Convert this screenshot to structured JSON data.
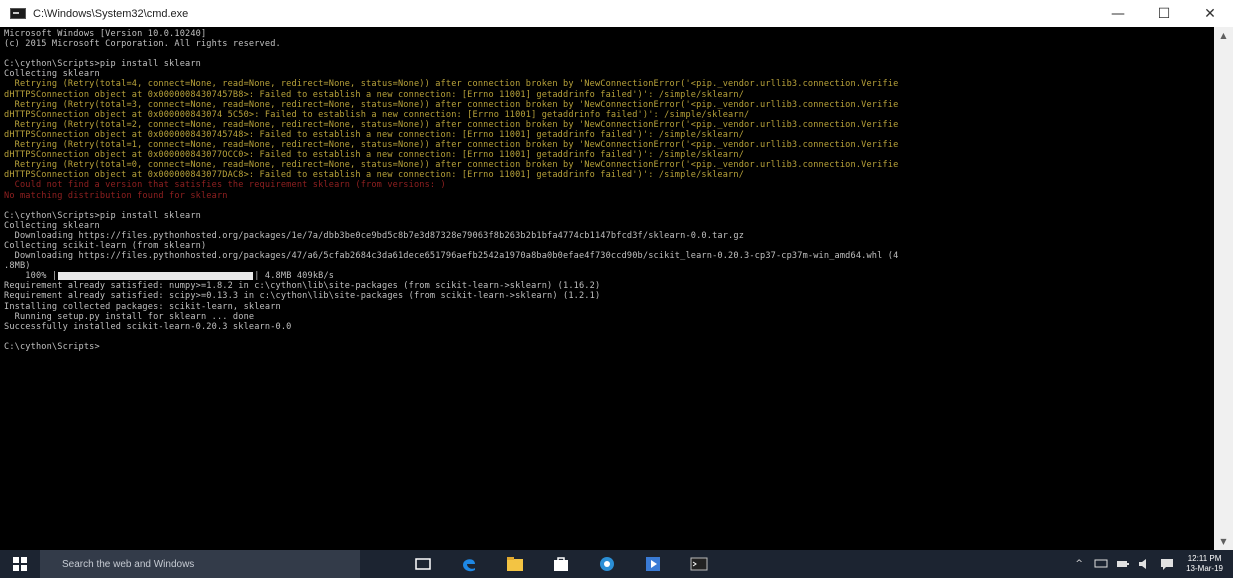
{
  "window": {
    "title": "C:\\Windows\\System32\\cmd.exe",
    "controls": {
      "minimize": "—",
      "maximize": "☐",
      "close": "✕"
    }
  },
  "console": {
    "lines": [
      {
        "text": "Microsoft Windows [Version 10.0.10240]",
        "style": "normal"
      },
      {
        "text": "(c) 2015 Microsoft Corporation. All rights reserved.",
        "style": "normal"
      },
      {
        "text": "",
        "style": "normal"
      },
      {
        "text": "C:\\cython\\Scripts>pip install sklearn",
        "style": "normal"
      },
      {
        "text": "Collecting sklearn",
        "style": "normal"
      },
      {
        "text": "  Retrying (Retry(total=4, connect=None, read=None, redirect=None, status=None)) after connection broken by 'NewConnectionError('<pip._vendor.urllib3.connection.Verifie",
        "style": "warn"
      },
      {
        "text": "dHTTPSConnection object at 0x00000084307457B8>: Failed to establish a new connection: [Errno 11001] getaddrinfo failed')': /simple/sklearn/",
        "style": "warn"
      },
      {
        "text": "  Retrying (Retry(total=3, connect=None, read=None, redirect=None, status=None)) after connection broken by 'NewConnectionError('<pip._vendor.urllib3.connection.Verifie",
        "style": "warn"
      },
      {
        "text": "dHTTPSConnection object at 0x000000843074 5C50>: Failed to establish a new connection: [Errno 11001] getaddrinfo failed')': /simple/sklearn/",
        "style": "warn"
      },
      {
        "text": "  Retrying (Retry(total=2, connect=None, read=None, redirect=None, status=None)) after connection broken by 'NewConnectionError('<pip._vendor.urllib3.connection.Verifie",
        "style": "warn"
      },
      {
        "text": "dHTTPSConnection object at 0x0000008430745748>: Failed to establish a new connection: [Errno 11001] getaddrinfo failed')': /simple/sklearn/",
        "style": "warn"
      },
      {
        "text": "  Retrying (Retry(total=1, connect=None, read=None, redirect=None, status=None)) after connection broken by 'NewConnectionError('<pip._vendor.urllib3.connection.Verifie",
        "style": "warn"
      },
      {
        "text": "dHTTPSConnection object at 0x000000843077OCC0>: Failed to establish a new connection: [Errno 11001] getaddrinfo failed')': /simple/sklearn/",
        "style": "warn"
      },
      {
        "text": "  Retrying (Retry(total=0, connect=None, read=None, redirect=None, status=None)) after connection broken by 'NewConnectionError('<pip._vendor.urllib3.connection.Verifie",
        "style": "warn"
      },
      {
        "text": "dHTTPSConnection object at 0x000000843077DAC8>: Failed to establish a new connection: [Errno 11001] getaddrinfo failed')': /simple/sklearn/",
        "style": "warn"
      },
      {
        "text": "  Could not find a version that satisfies the requirement sklearn (from versions: )",
        "style": "err"
      },
      {
        "text": "No matching distribution found for sklearn",
        "style": "err"
      },
      {
        "text": "",
        "style": "normal"
      },
      {
        "text": "C:\\cython\\Scripts>pip install sklearn",
        "style": "normal"
      },
      {
        "text": "Collecting sklearn",
        "style": "normal"
      },
      {
        "text": "  Downloading https://files.pythonhosted.org/packages/1e/7a/dbb3be0ce9bd5c8b7e3d87328e79063f8b263b2b1bfa4774cb1147bfcd3f/sklearn-0.0.tar.gz",
        "style": "normal"
      },
      {
        "text": "Collecting scikit-learn (from sklearn)",
        "style": "normal"
      },
      {
        "text": "  Downloading https://files.pythonhosted.org/packages/47/a6/5cfab2684c3da61dece651796aefb2542a1970a8ba0b0efae4f730ccd90b/scikit_learn-0.20.3-cp37-cp37m-win_amd64.whl (4",
        "style": "normal"
      },
      {
        "text": ".8MB)",
        "style": "normal"
      }
    ],
    "progress": {
      "percent_label": "    100% |",
      "fraction": 1.0,
      "suffix": "| 4.8MB 409kB/s"
    },
    "lines_after": [
      {
        "text": "Requirement already satisfied: numpy>=1.8.2 in c:\\cython\\lib\\site-packages (from scikit-learn->sklearn) (1.16.2)",
        "style": "normal"
      },
      {
        "text": "Requirement already satisfied: scipy>=0.13.3 in c:\\cython\\lib\\site-packages (from scikit-learn->sklearn) (1.2.1)",
        "style": "normal"
      },
      {
        "text": "Installing collected packages: scikit-learn, sklearn",
        "style": "normal"
      },
      {
        "text": "  Running setup.py install for sklearn ... done",
        "style": "normal"
      },
      {
        "text": "Successfully installed scikit-learn-0.20.3 sklearn-0.0",
        "style": "normal"
      },
      {
        "text": "",
        "style": "normal"
      },
      {
        "text": "C:\\cython\\Scripts>",
        "style": "normal"
      }
    ]
  },
  "taskbar": {
    "search_placeholder": "Search the web and Windows",
    "apps": [
      "task-view-icon",
      "edge-icon",
      "file-explorer-icon",
      "store-icon",
      "outlook-icon",
      "media-player-icon",
      "cmd-icon"
    ],
    "tray_icons": [
      "chevron-up-icon",
      "network-icon",
      "battery-icon",
      "volume-icon",
      "notifications-icon"
    ],
    "time": "12:11 PM",
    "date": "13-Mar-19"
  },
  "colors": {
    "console_bg": "#000000",
    "console_text": "#c0c0c0",
    "warning_text": "#b8a23a",
    "error_text": "#8f2020",
    "taskbar_bg": "#1c2431"
  }
}
